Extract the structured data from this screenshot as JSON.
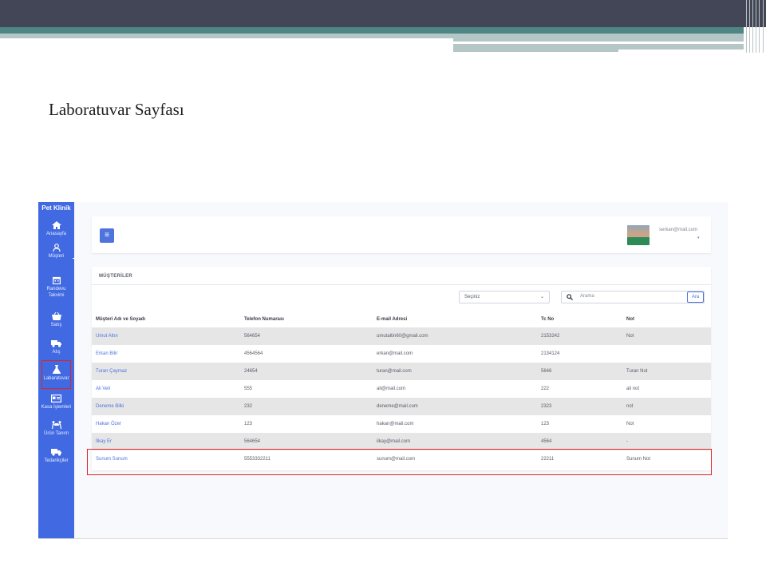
{
  "slide": {
    "title": "Laboratuvar Sayfası"
  },
  "sidebar": {
    "brand": "Pet Klinik",
    "items": [
      {
        "label": "Anasayfa",
        "icon": "home-icon"
      },
      {
        "label": "Müşteri",
        "icon": "user-icon"
      },
      {
        "label": "Randevu Takvimi",
        "icon": "calendar-icon"
      },
      {
        "label": "Satış",
        "icon": "basket-icon"
      },
      {
        "label": "Alış",
        "icon": "truck-icon"
      },
      {
        "label": "Labaratuvar",
        "icon": "flask-icon",
        "active": true
      },
      {
        "label": "Kasa İşlemleri",
        "icon": "id-card-icon"
      },
      {
        "label": "Ürün Tanım",
        "icon": "people-carry-icon"
      },
      {
        "label": "Tedarikçiler",
        "icon": "truck-icon"
      }
    ]
  },
  "topbar": {
    "menu_icon": "≡",
    "user_email": "serkan@mail.com",
    "user_caret": "▾"
  },
  "customers": {
    "title": "MÜŞTERİLER",
    "select_value": "Seçiniz",
    "search_placeholder": "Arama",
    "search_button": "Ara",
    "columns": [
      "Müşteri Adı ve Soyadı",
      "Telefon Numarası",
      "E-mail Adresi",
      "Tc No",
      "Not"
    ],
    "rows": [
      {
        "name": "Umut Altın",
        "phone": "564654",
        "email": "umutaltin60@gmail.com",
        "tc": "2153242",
        "note": "Not"
      },
      {
        "name": "Erkan Bilir",
        "phone": "4564564",
        "email": "erkan@mail.com",
        "tc": "2134124",
        "note": ""
      },
      {
        "name": "Turan Çaymaz",
        "phone": "24654",
        "email": "turan@mail.com",
        "tc": "5646",
        "note": "Turan Not"
      },
      {
        "name": "Ali Veli",
        "phone": "555",
        "email": "ali@mail.com",
        "tc": "222",
        "note": "ali not"
      },
      {
        "name": "Deneme Bilki",
        "phone": "232",
        "email": "deneme@mail.com",
        "tc": "2323",
        "note": "not"
      },
      {
        "name": "Hakan Özer",
        "phone": "123",
        "email": "hakan@mail.com",
        "tc": "123",
        "note": "Not"
      },
      {
        "name": "İlkay Er",
        "phone": "564654",
        "email": "ilkay@mail.com",
        "tc": "4564",
        "note": "-"
      },
      {
        "name": "Sunum Sunum",
        "phone": "5553332211",
        "email": "sunum@mail.com",
        "tc": "22211",
        "note": "Sunum Not",
        "highlighted": true
      }
    ]
  },
  "colors": {
    "sidebar": "#4169e1",
    "accent": "#4e73df",
    "highlight": "#e02424",
    "stripe": "#e6e6e6"
  }
}
